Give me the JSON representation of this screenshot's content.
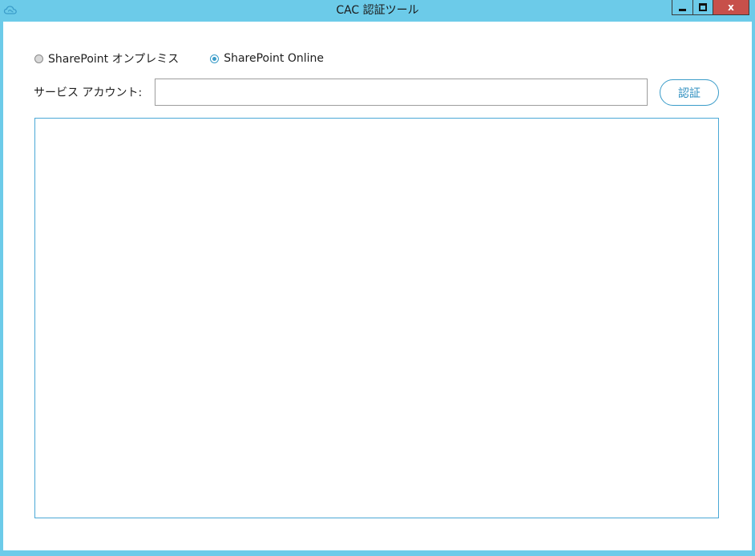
{
  "window": {
    "title": "CAC 認証ツール",
    "close_label": "x"
  },
  "icons": {
    "app": "cloud-icon",
    "minimize": "minimize-icon",
    "maximize": "maximize-icon",
    "close": "close-icon"
  },
  "environment": {
    "options": [
      {
        "label": "SharePoint オンプレミス",
        "selected": false
      },
      {
        "label": "SharePoint Online",
        "selected": true
      }
    ]
  },
  "service_account": {
    "label": "サービス アカウント:",
    "value": "",
    "placeholder": ""
  },
  "actions": {
    "authenticate_label": "認証"
  },
  "output": {
    "value": ""
  },
  "colors": {
    "titlebar": "#6ccbe9",
    "accent": "#3a9cc9",
    "close_button": "#c7504a"
  }
}
